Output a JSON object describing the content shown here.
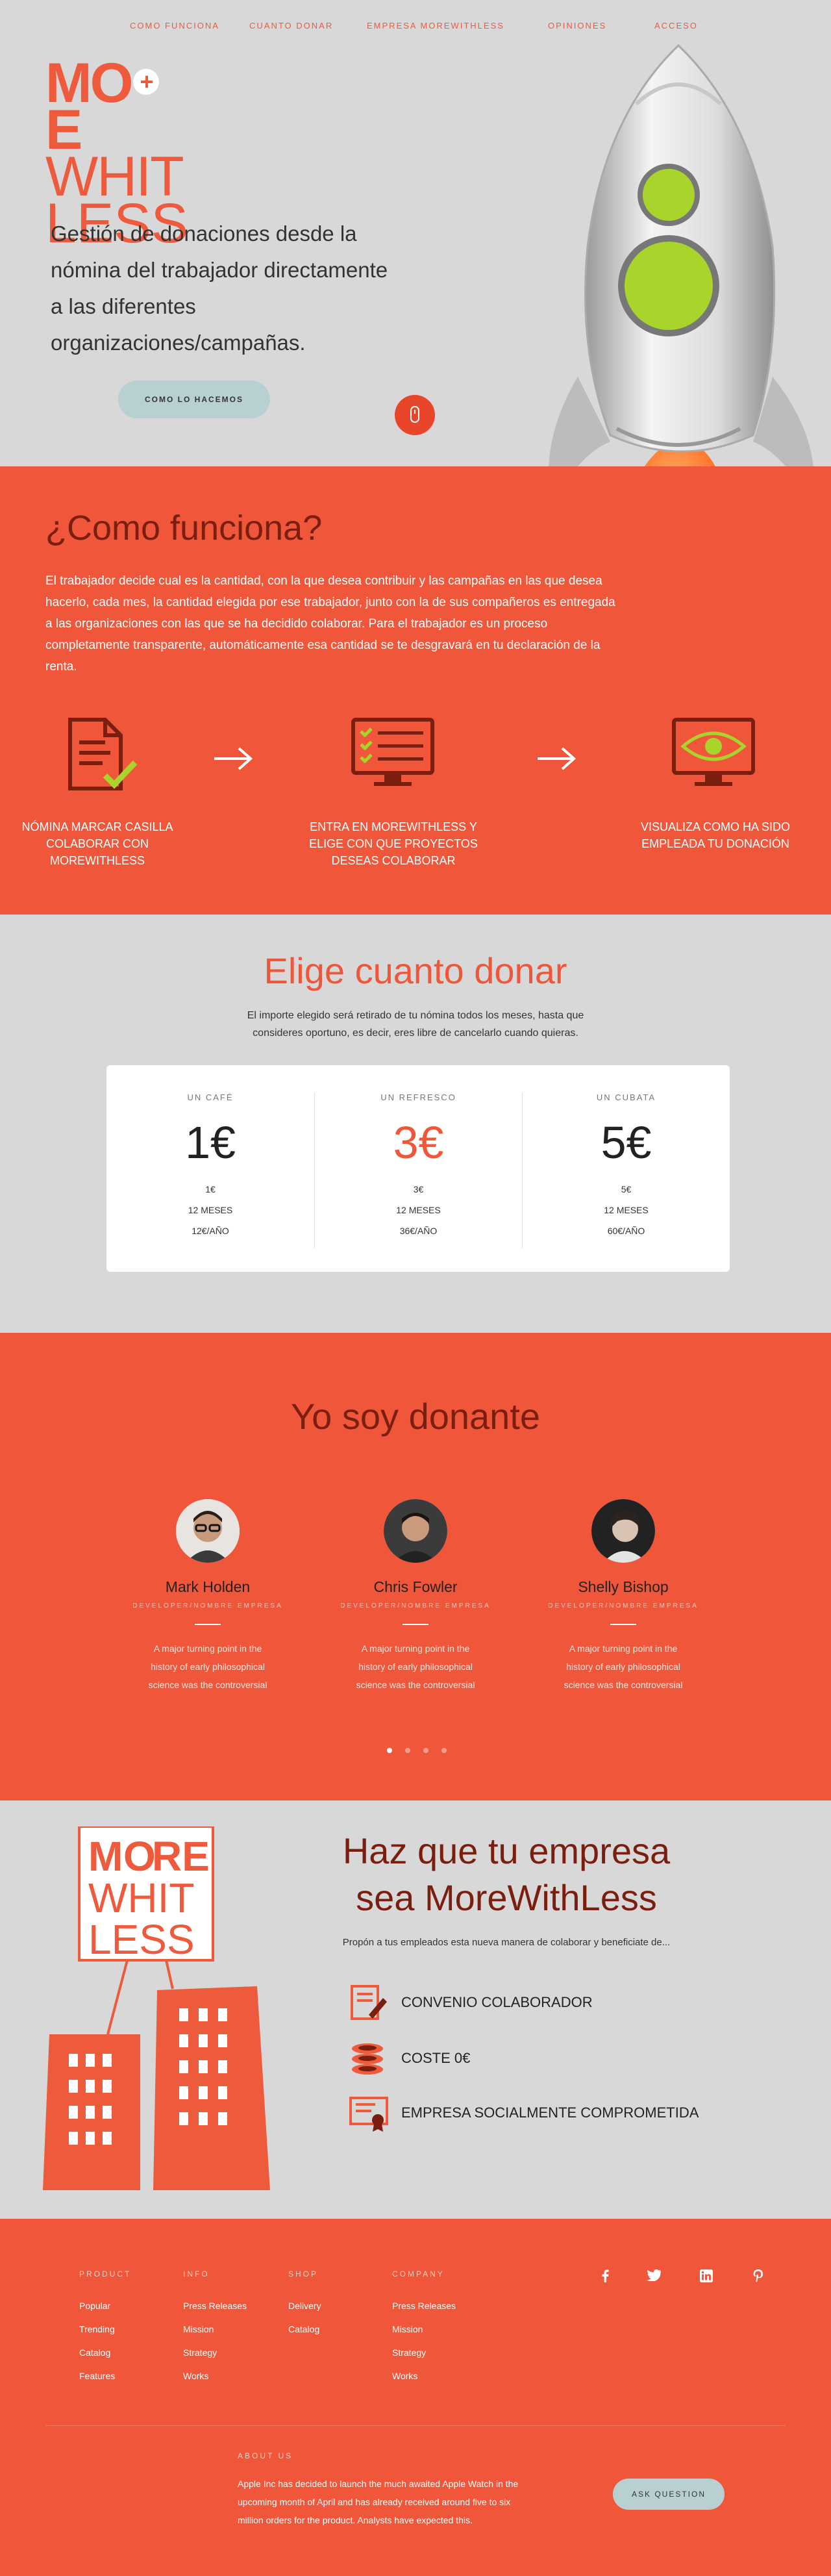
{
  "nav": {
    "items": [
      "Como funciona",
      "Cuanto donar",
      "Empresa MoreWithLess",
      "Opiniones",
      "Acceso"
    ]
  },
  "brand": {
    "line1": "MORE",
    "line2": "WHIT",
    "line3": "LESS",
    "plus": "+",
    "color": "#ee5a3c"
  },
  "hero": {
    "headline": "Gestión de donaciones desde la nómina del trabajador directamente a las diferentes organizaciones/campañas.",
    "button": "Como lo hacemos",
    "scroll_icon": "mouse-icon"
  },
  "funciona": {
    "title": "¿Como funciona?",
    "description": "El trabajador decide cual es la cantidad, con la que desea contribuir y las campañas en las que desea hacerlo, cada mes, la cantidad elegida por ese trabajador, junto con la de sus compañeros es entregada a las organizaciones con las que se ha decidido colaborar. Para el trabajador es un proceso completamente transparente, automáticamente esa cantidad se te desgravará en tu declaración de la renta.",
    "steps": [
      {
        "icon": "document-check-icon",
        "label": "Nómina marcar casilla colaborar con MoreWithLess"
      },
      {
        "icon": "monitor-checklist-icon",
        "label": "Entra en MoreWithLess y elige con que proyectos deseas colaborar"
      },
      {
        "icon": "monitor-eye-icon",
        "label": "Visualiza como ha sido empleada tu donación"
      }
    ],
    "arrow_icon": "arrow-right-icon"
  },
  "donar": {
    "title": "Elige cuanto donar",
    "subtitle": "El importe elegido será retirado de tu nómina todos los meses, hasta que consideres oportuno, es decir, eres libre de cancelarlo cuando quieras.",
    "plans": [
      {
        "name": "Un café",
        "price": "1€",
        "lines": [
          "1€",
          "12 MESES",
          "12€/AÑO"
        ]
      },
      {
        "name": "Un refresco",
        "price": "3€",
        "lines": [
          "3€",
          "12 MESES",
          "36€/AÑO"
        ]
      },
      {
        "name": "Un cubata",
        "price": "5€",
        "lines": [
          "5€",
          "12 MESES",
          "60€/AÑO"
        ]
      }
    ],
    "highlight_color": "#f0563a"
  },
  "donante": {
    "title": "Yo soy donante",
    "people": [
      {
        "name": "Mark Holden",
        "role": "Developer/Nombre empresa",
        "quote": "A major turning point in the history of early philosophical science was the controversial"
      },
      {
        "name": "Chris Fowler",
        "role": "Developer/Nombre empresa",
        "quote": "A major turning point in the history of early philosophical science was the controversial"
      },
      {
        "name": "Shelly Bishop",
        "role": "Developer/Nombre empresa",
        "quote": "A major turning point in the history of early philosophical science was the controversial"
      }
    ]
  },
  "empresa": {
    "title": "Haz que tu empresa sea MoreWithLess",
    "subtitle": "Propón a tus empleados esta nueva manera de colaborar y beneficiate de...",
    "features": [
      {
        "icon": "contract-pen-icon",
        "label": "Convenio colaborador"
      },
      {
        "icon": "coins-stack-icon",
        "label": "Coste 0€"
      },
      {
        "icon": "certificate-icon",
        "label": "Empresa socialmente comprometida"
      }
    ]
  },
  "footer": {
    "columns": [
      {
        "heading": "Product",
        "links": [
          "Popular",
          "Trending",
          "Catalog",
          "Features"
        ]
      },
      {
        "heading": "Info",
        "links": [
          "Press Releases",
          "Mission",
          "Strategy",
          "Works"
        ]
      },
      {
        "heading": "Shop",
        "links": [
          "Delivery",
          "Catalog"
        ]
      },
      {
        "heading": "Company",
        "links": [
          "Press Releases",
          "Mission",
          "Strategy",
          "Works"
        ]
      }
    ],
    "social": [
      "facebook-icon",
      "twitter-icon",
      "linkedin-icon",
      "pinterest-icon"
    ],
    "about_heading": "About us",
    "about_text": "Apple Inc has decided to launch the much awaited Apple Watch in the upcoming month of April and has already received around five to six million orders for the product. Analysts have expected this.",
    "ask_button": "Ask question"
  }
}
